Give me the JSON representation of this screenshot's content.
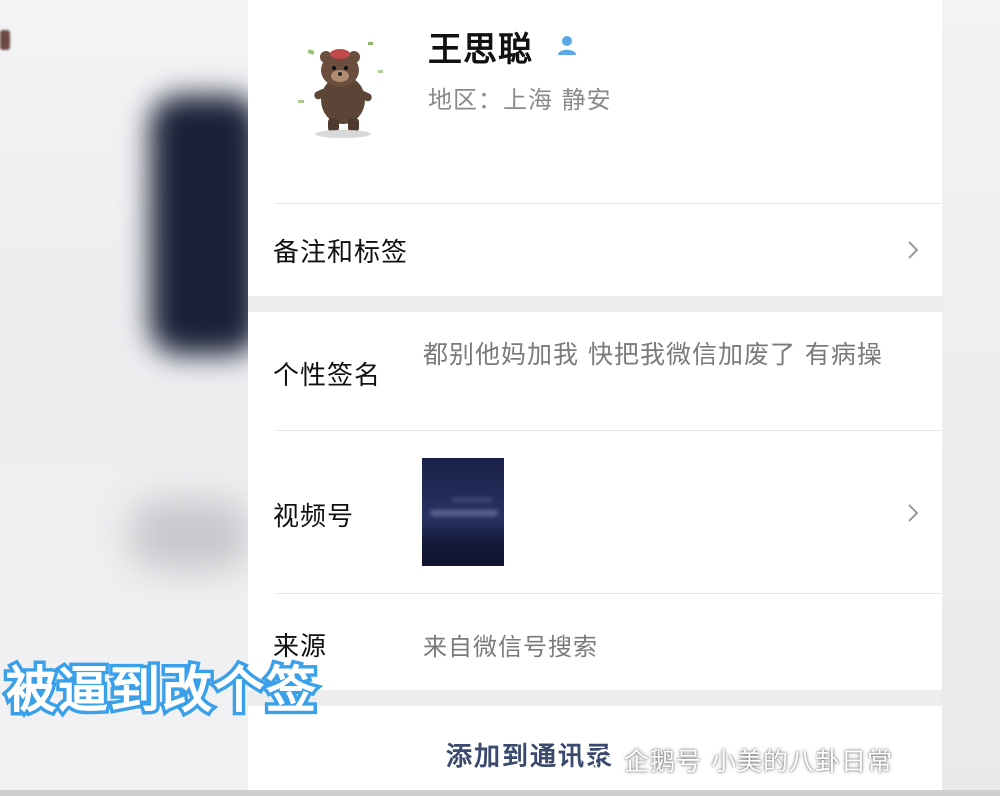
{
  "profile": {
    "name": "王思聪",
    "region": "地区：上海 静安",
    "avatar": "bear-sticker-avatar"
  },
  "rows": {
    "remarks": {
      "label": "备注和标签"
    },
    "signature": {
      "label": "个性签名",
      "value": "都别他妈加我 快把我微信加废了 有病操"
    },
    "channels": {
      "label": "视频号"
    },
    "source": {
      "label": "来源",
      "value": "来自微信号搜索"
    }
  },
  "actions": {
    "add_contact": "添加到通讯录"
  },
  "overlay": {
    "caption": "被逼到改个签",
    "watermark": "企鹅号 小美的八卦日常"
  },
  "colors": {
    "caption_stroke": "#3aa0ea",
    "person_icon": "#5aa9e6",
    "button_text": "#3a4a6e"
  }
}
